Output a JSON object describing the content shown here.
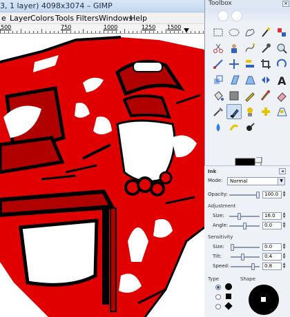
{
  "window": {
    "title": "3, 1 layer) 4098x3074 – GIMP"
  },
  "menu": {
    "items": [
      "e",
      "Layer",
      "Colors",
      "Tools",
      "Filters",
      "Windows",
      "Help"
    ]
  },
  "ruler": {
    "labels": [
      "500",
      "750",
      "1000",
      "1250",
      "1500"
    ]
  },
  "toolbox": {
    "title": "Toolbox",
    "close": "×",
    "tools": [
      {
        "name": "rect-select-icon"
      },
      {
        "name": "ellipse-select-icon"
      },
      {
        "name": "free-select-icon"
      },
      {
        "name": "fuzzy-select-icon"
      },
      {
        "name": "color-select-icon"
      },
      {
        "name": "scissors-icon"
      },
      {
        "name": "foreground-select-icon"
      },
      {
        "name": "paths-icon"
      },
      {
        "name": "color-picker-icon"
      },
      {
        "name": "zoom-icon"
      },
      {
        "name": "measure-icon"
      },
      {
        "name": "move-icon"
      },
      {
        "name": "align-icon"
      },
      {
        "name": "crop-icon"
      },
      {
        "name": "rotate-icon"
      },
      {
        "name": "scale-icon"
      },
      {
        "name": "shear-icon"
      },
      {
        "name": "perspective-icon"
      },
      {
        "name": "flip-icon"
      },
      {
        "name": "text-icon"
      },
      {
        "name": "bucket-fill-icon"
      },
      {
        "name": "blend-icon"
      },
      {
        "name": "pencil-icon"
      },
      {
        "name": "paintbrush-icon"
      },
      {
        "name": "eraser-icon"
      },
      {
        "name": "airbrush-icon"
      },
      {
        "name": "ink-icon"
      },
      {
        "name": "clone-icon"
      },
      {
        "name": "heal-icon"
      },
      {
        "name": "perspective-clone-icon"
      },
      {
        "name": "blur-icon"
      },
      {
        "name": "smudge-icon"
      },
      {
        "name": "dodge-burn-icon"
      }
    ],
    "active_tool": "ink-icon"
  },
  "colors": {
    "foreground": "#000000",
    "background": "#ffffff",
    "accent": "#ee0000"
  },
  "tool_options": {
    "tool_name": "Ink",
    "mode_label": "Mode:",
    "mode_value": "Normal",
    "opacity_label": "Opacity:",
    "opacity_value": "100.0",
    "opacity_level": 1.0,
    "adjustment_heading": "Adjustment",
    "size_label": "Size:",
    "size_value": "16.0",
    "size_level": 0.3,
    "angle_label": "Angle:",
    "angle_value": "0.0",
    "angle_level": 0.5,
    "sensitivity_heading": "Sensitivity",
    "sens_size_label": "Size:",
    "sens_size_value": "0.0",
    "sens_size_level": 0.0,
    "tilt_label": "Tilt:",
    "tilt_value": "0.4",
    "tilt_level": 0.4,
    "speed_label": "Speed:",
    "speed_value": "0.8",
    "speed_level": 0.8,
    "type_heading": "Type",
    "shape_heading": "Shape"
  }
}
